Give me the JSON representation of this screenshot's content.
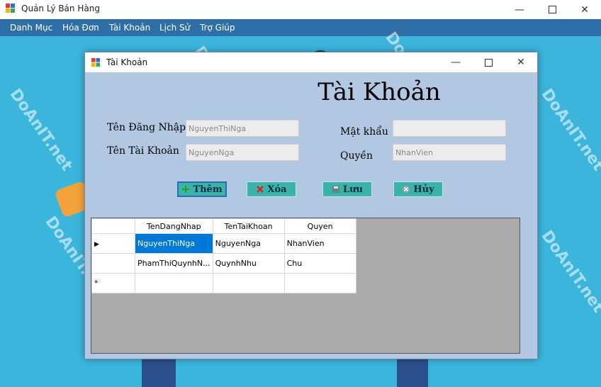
{
  "main_window": {
    "title": "Quản Lý Bán Hàng",
    "menu": [
      "Danh Mục",
      "Hóa Đơn",
      "Tài Khoản",
      "Lịch Sử",
      "Trợ Giúp"
    ]
  },
  "dialog": {
    "title": "Tài Khoản",
    "heading": "Tài Khoản",
    "labels": {
      "username": "Tên Đăng Nhập",
      "account_name": "Tên Tài Khoản",
      "password": "Mật khẩu",
      "role": "Quyền"
    },
    "fields": {
      "username": "NguyenThiNga",
      "account_name": "NguyenNga",
      "password": "",
      "role": "NhanVien"
    },
    "buttons": {
      "add": "Thêm",
      "delete": "Xóa",
      "save": "Lưu",
      "cancel": "Hủy"
    },
    "grid": {
      "columns": [
        "TenDangNhap",
        "TenTaiKhoan",
        "Quyen"
      ],
      "rows": [
        [
          "NguyenThiNga",
          "NguyenNga",
          "NhanVien"
        ],
        [
          "PhamThiQuynhN...",
          "QuynhNhu",
          "Chu"
        ]
      ],
      "new_row_marker": "*"
    }
  },
  "watermark": "DoAnIT.net",
  "colors": {
    "desktop_bg": "#3cb5dc",
    "menubar": "#2f6fa8",
    "dialog_bg": "#b1c7e2",
    "button": "#3ab3a8",
    "selection": "#0078d7"
  }
}
